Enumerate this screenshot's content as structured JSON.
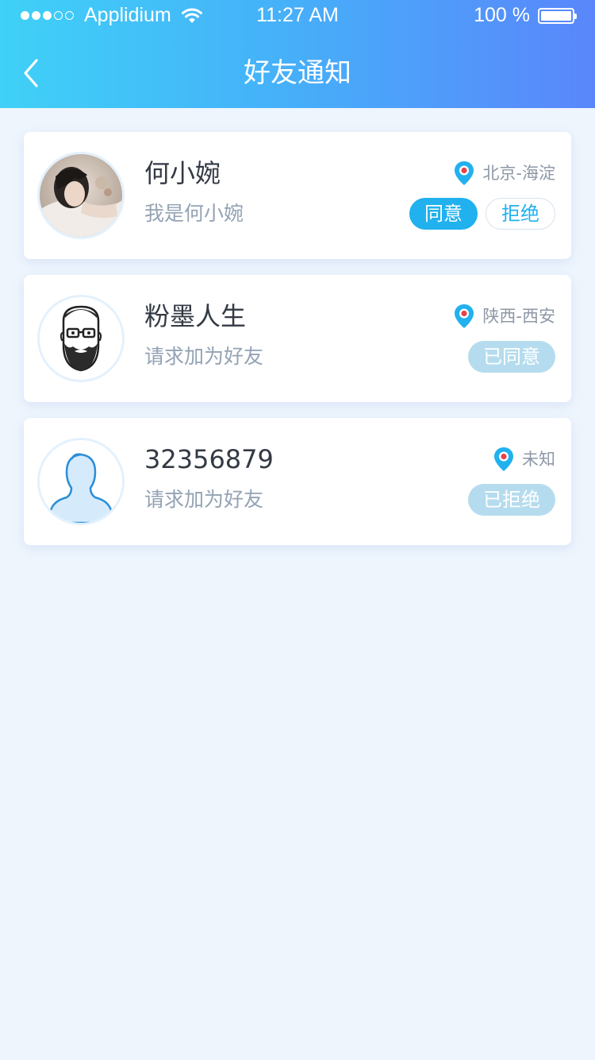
{
  "status_bar": {
    "carrier": "Applidium",
    "time": "11:27 AM",
    "battery": "100 %",
    "signal_strength": 3
  },
  "nav": {
    "title": "好友通知",
    "back_icon": "chevron-left-icon"
  },
  "colors": {
    "accent": "#21b1ee",
    "header_start": "#3fd1f7",
    "header_end": "#5a86fb",
    "background": "#eef5fd",
    "status_pill": "#b5dcee"
  },
  "notifications": [
    {
      "name": "何小婉",
      "message": "我是何小婉",
      "location": "北京-海淀",
      "avatar": "photo-avatar",
      "agree_label": "同意",
      "reject_label": "拒绝"
    },
    {
      "name": "粉墨人生",
      "message": "请求加为好友",
      "location": "陕西-西安",
      "avatar": "bearded-man-avatar",
      "status": "已同意"
    },
    {
      "name": "32356879",
      "message": "请求加为好友",
      "location": "未知",
      "avatar": "default-user-avatar",
      "status": "已拒绝"
    }
  ]
}
